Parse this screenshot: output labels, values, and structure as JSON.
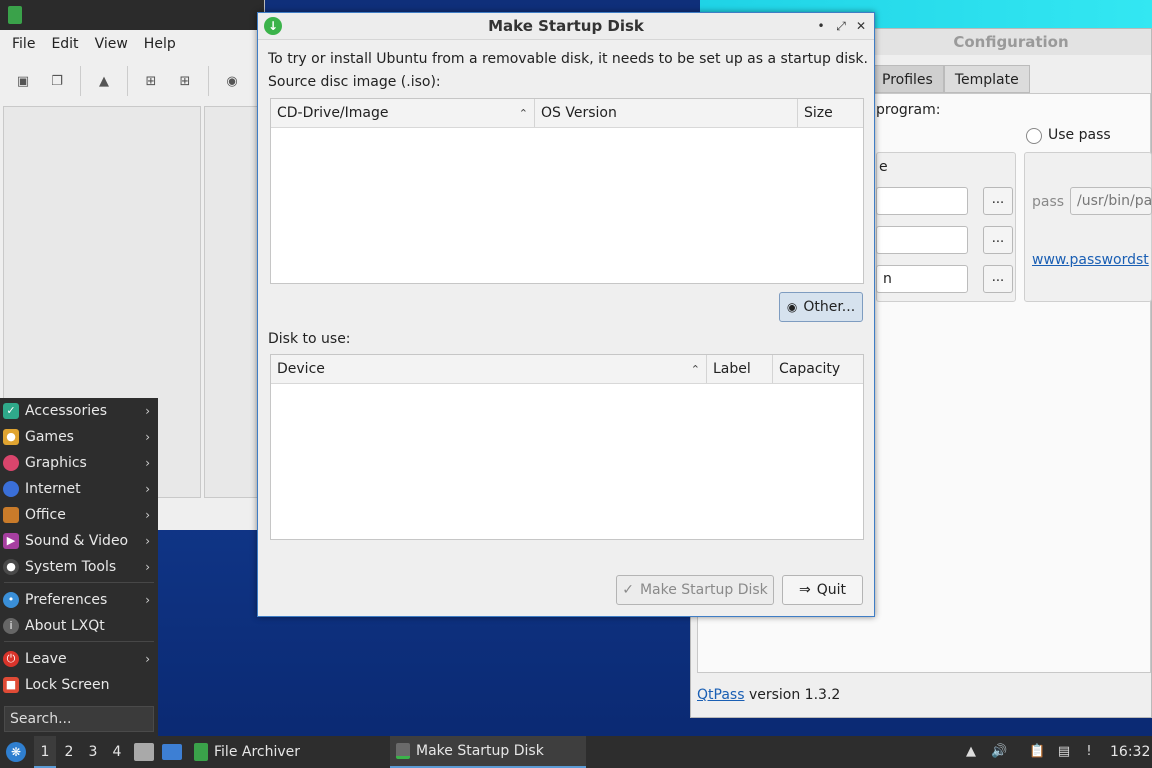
{
  "file_archiver": {
    "title": "File Archiver",
    "menu": [
      "File",
      "Edit",
      "View",
      "Help"
    ],
    "toolbar_icons": [
      "new-archive-icon",
      "copy-icon",
      "extract-icon",
      "add-file-icon",
      "add-folder-icon",
      "stop-icon"
    ]
  },
  "configuration": {
    "title": "Configuration",
    "tabs": [
      "Profiles",
      "Template"
    ],
    "program_label": "program:",
    "use_pass_label": "Use pass",
    "group_label_fragment": "e",
    "field3_fragment": "n",
    "dots_label": "...",
    "pass_label": "pass",
    "pass_path": "/usr/bin/pa",
    "website_link": "www.passwordst",
    "footer_link": "QtPass",
    "footer_version": "version 1.3.2"
  },
  "dialog": {
    "title": "Make Startup Disk",
    "intro_text": "To try or install Ubuntu from a removable disk, it needs to be set up as a startup disk.",
    "source_label": "Source disc image (.iso):",
    "source_columns": [
      "CD-Drive/Image",
      "OS Version",
      "Size"
    ],
    "other_button": "Other...",
    "disk_label": "Disk to use:",
    "disk_columns": [
      "Device",
      "Label",
      "Capacity"
    ],
    "make_button": "Make Startup Disk",
    "quit_button": "Quit"
  },
  "start_menu": {
    "items": [
      {
        "label": "Accessories",
        "icon": "accessories-icon",
        "color": "#2fa98a",
        "submenu": true
      },
      {
        "label": "Games",
        "icon": "games-icon",
        "color": "#e0a431",
        "submenu": true
      },
      {
        "label": "Graphics",
        "icon": "graphics-icon",
        "color": "#d9456c",
        "submenu": true
      },
      {
        "label": "Internet",
        "icon": "internet-icon",
        "color": "#3a6fd8",
        "submenu": true
      },
      {
        "label": "Office",
        "icon": "office-icon",
        "color": "#c97b2a",
        "submenu": true
      },
      {
        "label": "Sound & Video",
        "icon": "sound-video-icon",
        "color": "#a63fa0",
        "submenu": true
      },
      {
        "label": "System Tools",
        "icon": "system-tools-icon",
        "color": "#4a4a4a",
        "submenu": true
      },
      {
        "label": "Preferences",
        "icon": "preferences-icon",
        "color": "#3a8fd8",
        "submenu": true
      },
      {
        "label": "About LXQt",
        "icon": "about-icon",
        "color": "#666666",
        "submenu": false
      },
      {
        "label": "Leave",
        "icon": "leave-icon",
        "color": "#d9342b",
        "submenu": true
      },
      {
        "label": "Lock Screen",
        "icon": "lock-icon",
        "color": "#e04b36",
        "submenu": false
      }
    ],
    "search_placeholder": "Search..."
  },
  "taskbar": {
    "desktops": [
      "1",
      "2",
      "3",
      "4"
    ],
    "active_desktop": "1",
    "tasks": [
      {
        "label": "File Archiver",
        "icon": "file-archiver-icon"
      },
      {
        "label": "Make Startup Disk",
        "icon": "startup-disk-icon"
      }
    ],
    "clock": "16:32"
  }
}
